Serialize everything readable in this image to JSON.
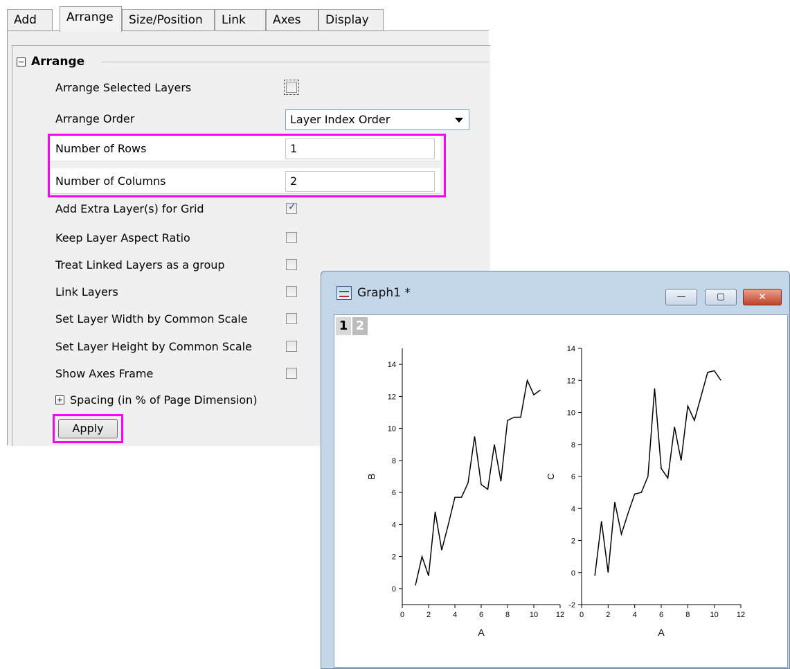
{
  "tabs": [
    {
      "label": "Add",
      "active": false
    },
    {
      "label": "Arrange",
      "active": true
    },
    {
      "label": "Size/Position",
      "active": false
    },
    {
      "label": "Link",
      "active": false
    },
    {
      "label": "Axes",
      "active": false
    },
    {
      "label": "Display",
      "active": false
    }
  ],
  "section": {
    "title": "Arrange"
  },
  "rows": {
    "arrange_selected": {
      "label": "Arrange Selected Layers",
      "checked": false
    },
    "arrange_order": {
      "label": "Arrange Order",
      "value": "Layer Index Order"
    },
    "num_rows": {
      "label": "Number of Rows",
      "value": "1"
    },
    "num_cols": {
      "label": "Number of Columns",
      "value": "2"
    },
    "add_extra": {
      "label": "Add Extra Layer(s) for Grid",
      "checked": true
    },
    "keep_aspect": {
      "label": "Keep Layer Aspect Ratio",
      "checked": false
    },
    "treat_linked": {
      "label": "Treat Linked Layers as a group",
      "checked": false
    },
    "link_layers": {
      "label": "Link Layers",
      "checked": false
    },
    "set_width": {
      "label": "Set Layer Width by Common Scale",
      "checked": false
    },
    "set_height": {
      "label": "Set Layer Height by Common Scale",
      "checked": false
    },
    "show_frame": {
      "label": "Show Axes Frame",
      "checked": false
    }
  },
  "spacing": {
    "label": "Spacing (in % of Page Dimension)"
  },
  "apply_label": "Apply",
  "graph_window": {
    "title": "Graph1 *",
    "layer_tabs": [
      "1",
      "2"
    ],
    "min_glyph": "—",
    "max_glyph": "▢",
    "close_glyph": "✕"
  },
  "chart_data": [
    {
      "type": "line",
      "xlabel": "A",
      "ylabel": "B",
      "xlim": [
        0,
        12
      ],
      "ylim": [
        -1,
        15
      ],
      "xticks": [
        0,
        2,
        4,
        6,
        8,
        10,
        12
      ],
      "yticks": [
        0,
        2,
        4,
        6,
        8,
        10,
        12,
        14
      ],
      "x": [
        1,
        1.5,
        2,
        2.5,
        3,
        3.5,
        4,
        4.5,
        5,
        5.5,
        6,
        6.5,
        7,
        7.5,
        8,
        8.5,
        9,
        9.5,
        10,
        10.5
      ],
      "series": [
        {
          "values": [
            0.2,
            2.0,
            0.8,
            4.8,
            2.4,
            4.0,
            5.7,
            5.7,
            6.6,
            9.5,
            6.5,
            6.2,
            9.0,
            6.7,
            10.5,
            10.7,
            10.7,
            13.0,
            12.1,
            12.4
          ]
        }
      ]
    },
    {
      "type": "line",
      "xlabel": "A",
      "ylabel": "C",
      "xlim": [
        0,
        12
      ],
      "ylim": [
        -2,
        14
      ],
      "xticks": [
        0,
        2,
        4,
        6,
        8,
        10,
        12
      ],
      "yticks": [
        -2,
        0,
        2,
        4,
        6,
        8,
        10,
        12,
        14
      ],
      "x": [
        1,
        1.5,
        2,
        2.5,
        3,
        3.5,
        4,
        4.5,
        5,
        5.5,
        6,
        6.5,
        7,
        7.5,
        8,
        8.5,
        9,
        9.5,
        10,
        10.5
      ],
      "series": [
        {
          "values": [
            -0.2,
            3.2,
            0.0,
            4.4,
            2.4,
            3.7,
            4.9,
            5.0,
            6.0,
            11.5,
            6.5,
            5.9,
            9.1,
            7.0,
            10.4,
            9.5,
            11.0,
            12.5,
            12.6,
            12.0
          ]
        }
      ]
    }
  ]
}
